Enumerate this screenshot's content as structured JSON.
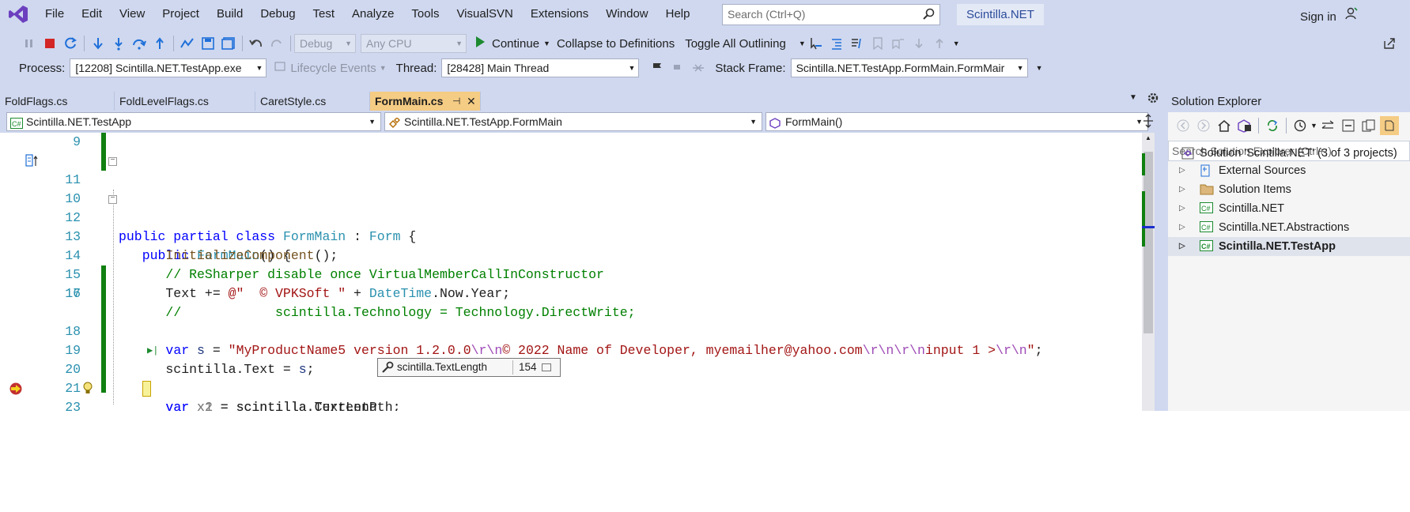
{
  "menu": {
    "items": [
      "File",
      "Edit",
      "View",
      "Project",
      "Build",
      "Debug",
      "Test",
      "Analyze",
      "Tools",
      "VisualSVN",
      "Extensions",
      "Window",
      "Help"
    ],
    "search_placeholder": "Search (Ctrl+Q)",
    "solution_name": "Scintilla.NET",
    "sign_in": "Sign in"
  },
  "toolbar": {
    "config": "Debug",
    "platform": "Any CPU",
    "continue_label": "Continue",
    "collapse_label": "Collapse to Definitions",
    "toggle_label": "Toggle All Outlining"
  },
  "debugbar": {
    "process_label": "Process:",
    "process_value": "[12208] Scintilla.NET.TestApp.exe",
    "lifecycle_label": "Lifecycle Events",
    "thread_label": "Thread:",
    "thread_value": "[28428] Main Thread",
    "stackframe_label": "Stack Frame:",
    "stackframe_value": "Scintilla.NET.TestApp.FormMain.FormMair"
  },
  "tabs": [
    "FoldFlags.cs",
    "FoldLevelFlags.cs",
    "CaretStyle.cs",
    "FormMain.cs"
  ],
  "navbar": {
    "project": "Scintilla.NET.TestApp",
    "type": "Scintilla.NET.TestApp.FormMain",
    "member": "FormMain()"
  },
  "editor": {
    "line_numbers": [
      "9",
      "10",
      "11",
      "12",
      "13",
      "14",
      "15",
      "16",
      "17",
      "18",
      "19",
      "20",
      "21",
      "22",
      "23"
    ],
    "current_line": "22"
  },
  "tooltip": {
    "expression": "scintilla.TextLength",
    "value": "154"
  },
  "solution_explorer": {
    "title": "Solution Explorer",
    "search_placeholder": "Search Solution Explorer (Ctrl+;)",
    "solution": "Solution 'Scintilla.NET' (3 of 3 projects)",
    "items": [
      "External Sources",
      "Solution Items",
      "Scintilla.NET",
      "Scintilla.NET.Abstractions",
      "Scintilla.NET.TestApp"
    ]
  },
  "colors": {
    "accent": "#f5cc84",
    "chrome": "#cfd8ef",
    "change_bar": "#108010"
  }
}
